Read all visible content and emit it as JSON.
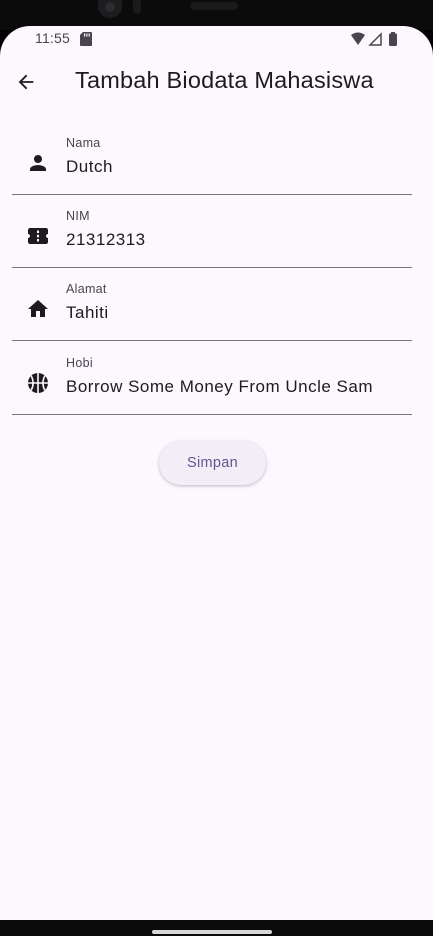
{
  "status_bar": {
    "time": "11:55",
    "icons": [
      "sd-card-icon",
      "wifi-icon",
      "signal-icon",
      "battery-icon"
    ]
  },
  "app_bar": {
    "title": "Tambah Biodata Mahasiswa",
    "back_icon": "arrow-back-icon"
  },
  "form": {
    "fields": [
      {
        "icon": "person-icon",
        "label": "Nama",
        "value": "Dutch"
      },
      {
        "icon": "badge-icon",
        "label": "NIM",
        "value": "21312313"
      },
      {
        "icon": "home-icon",
        "label": "Alamat",
        "value": "Tahiti"
      },
      {
        "icon": "basketball-icon",
        "label": "Hobi",
        "value": "Borrow Some Money From Uncle Sam"
      }
    ],
    "submit_label": "Simpan"
  },
  "colors": {
    "background": "#fdf7fe",
    "text": "#1d1b20",
    "label": "#49454f",
    "divider": "#79747e",
    "button_bg": "#f3edf7",
    "button_text": "#65558f"
  }
}
